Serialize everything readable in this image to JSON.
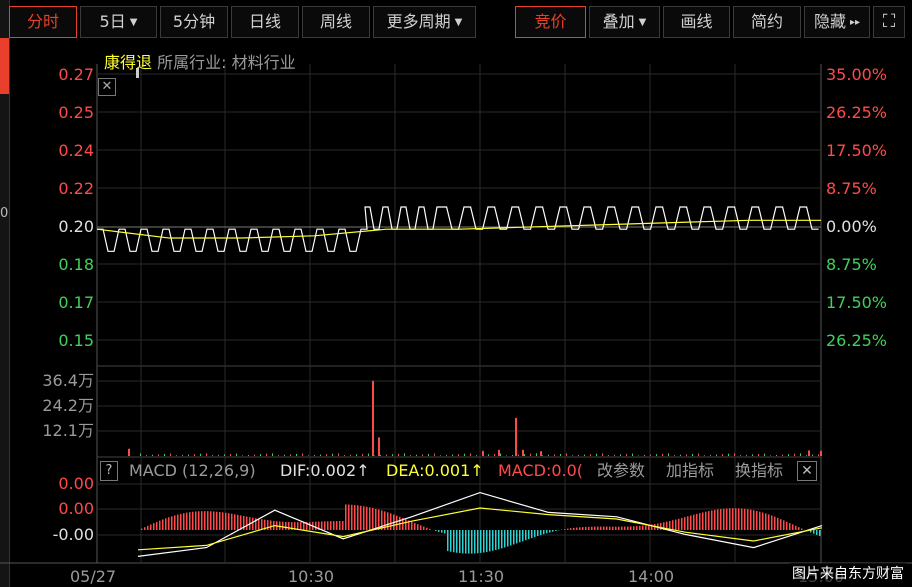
{
  "toolbar": {
    "left_buttons": [
      "分时",
      "5日",
      "5分钟",
      "日线",
      "周线",
      "更多周期"
    ],
    "right_buttons": [
      "竞价",
      "叠加",
      "画线",
      "简约",
      "隐藏"
    ],
    "dropdown_arrow": "▼",
    "expand_arrow": "▸▸",
    "fullscreen_glyph": "⛶"
  },
  "side_fragment": "0",
  "stock": {
    "name": "康得退",
    "industry_label": "所属行业:",
    "industry_value": "材料行业"
  },
  "price_axis_left": [
    "0.27",
    "0.25",
    "0.24",
    "0.22",
    "0.20",
    "0.18",
    "0.17",
    "0.15"
  ],
  "price_axis_right": [
    "35.00%",
    "26.25%",
    "17.50%",
    "8.75%",
    "0.00%",
    "8.75%",
    "17.50%",
    "26.25%"
  ],
  "volume_axis": [
    "36.4万",
    "24.2万",
    "12.1万"
  ],
  "macd_header": {
    "help": "?",
    "title": "MACD (12,26,9)",
    "dif": "DIF:0.002↑",
    "dea": "DEA:0.001↑",
    "macd": "MACD:0.0(",
    "change_params": "改参数",
    "add_indicator": "加指标",
    "switch_indicator": "换指标",
    "close": "✕"
  },
  "macd_axis": [
    "0.00",
    "0.00",
    "-0.00"
  ],
  "time_axis": [
    "05/27",
    "10:30",
    "11:30",
    "14:00",
    "15:00"
  ],
  "watermark": "图片来自东方财富",
  "colors": {
    "up": "#ff4a4a",
    "down": "#3fd15a",
    "accent": "#e8402b",
    "avg_line": "#ffff33",
    "price_line": "#ffffff",
    "macd_neg": "#30d0d0"
  },
  "chart_data": [
    {
      "type": "line",
      "x": [
        "09:30",
        "10:00",
        "10:30",
        "10:50",
        "11:00",
        "11:30",
        "13:00",
        "13:30",
        "14:00",
        "14:30",
        "15:00"
      ],
      "series": [
        {
          "values": [
            0.2,
            0.19,
            0.19,
            0.19,
            0.21,
            0.2,
            0.21,
            0.21,
            0.21,
            0.21,
            0.21
          ]
        },
        {
          "values": [
            0.2,
            0.196,
            0.196,
            0.197,
            0.2,
            0.2,
            0.201,
            0.202,
            0.203,
            0.204,
            0.204
          ]
        }
      ],
      "ylim": [
        0.15,
        0.27
      ],
      "grid": true
    },
    {
      "type": "bar",
      "x": [
        "09:30",
        "10:50",
        "11:30",
        "11:42",
        "15:00"
      ],
      "values": [
        3.5,
        36.4,
        2.5,
        18.5,
        2.7
      ],
      "ylim": [
        0,
        36.4
      ],
      "grid": true
    },
    {
      "type": "line",
      "series": [
        {
          "values": [
            -0.0012,
            -0.0008,
            0.0009,
            -0.0004,
            0.0006,
            0.0017,
            0.0008,
            0.0006,
            -0.0002,
            -0.0008,
            0.0002
          ]
        },
        {
          "values": [
            -0.0009,
            -0.0007,
            0.0002,
            -0.0003,
            0.0004,
            0.001,
            0.0007,
            0.0005,
            -0.0001,
            -0.0005,
            0.0001
          ]
        }
      ],
      "grid": true
    }
  ]
}
